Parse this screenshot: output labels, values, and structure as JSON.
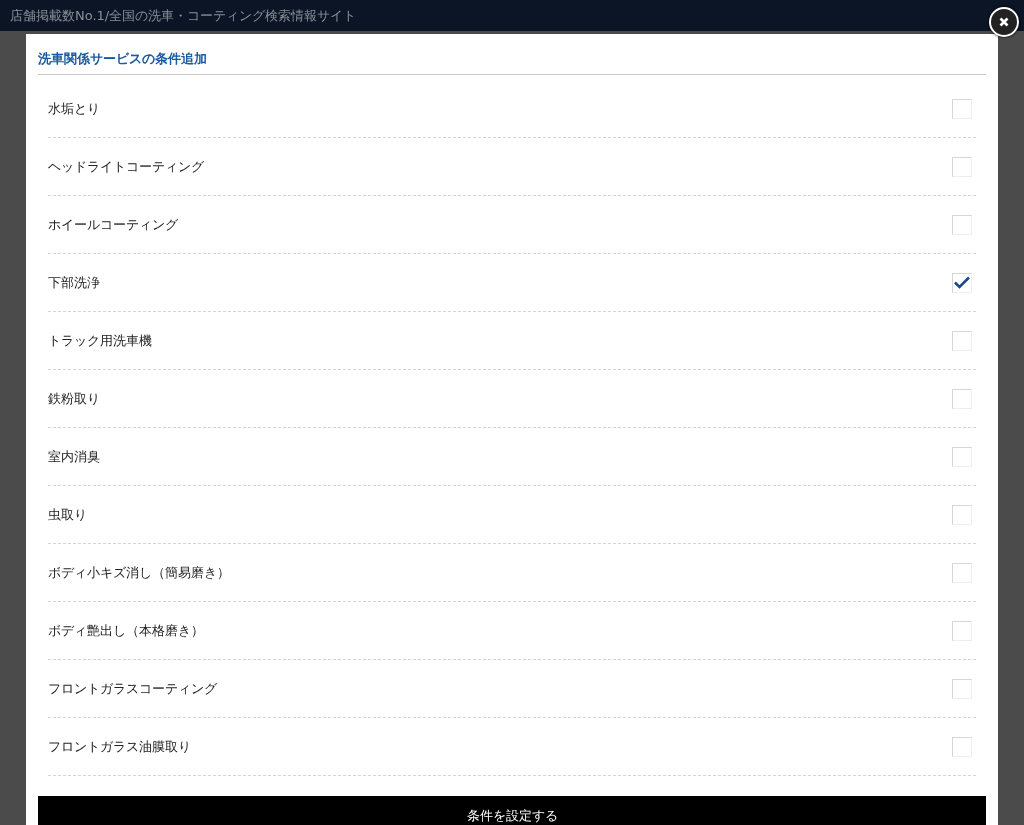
{
  "background_header": {
    "tagline": "店舗掲載数No.1/全国の洗車・コーティング検索情報サイト"
  },
  "modal": {
    "title": "洗車関係サービスの条件追加",
    "options": [
      {
        "label": "水垢とり",
        "checked": false
      },
      {
        "label": "ヘッドライトコーティング",
        "checked": false
      },
      {
        "label": "ホイールコーティング",
        "checked": false
      },
      {
        "label": "下部洗浄",
        "checked": true
      },
      {
        "label": "トラック用洗車機",
        "checked": false
      },
      {
        "label": "鉄粉取り",
        "checked": false
      },
      {
        "label": "室内消臭",
        "checked": false
      },
      {
        "label": "虫取り",
        "checked": false
      },
      {
        "label": "ボディ小キズ消し（簡易磨き）",
        "checked": false
      },
      {
        "label": "ボディ艶出し（本格磨き）",
        "checked": false
      },
      {
        "label": "フロントガラスコーティング",
        "checked": false
      },
      {
        "label": "フロントガラス油膜取り",
        "checked": false
      }
    ],
    "submit": "条件を設定する"
  }
}
